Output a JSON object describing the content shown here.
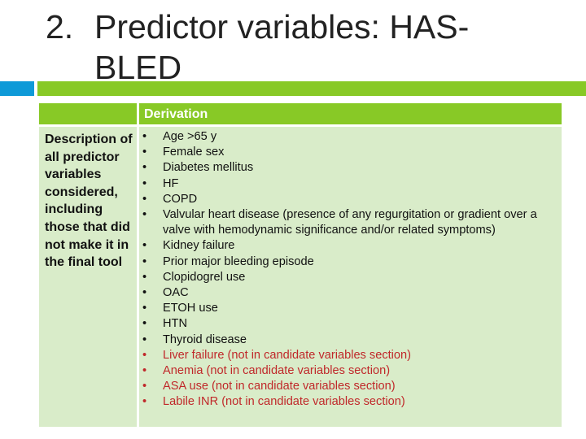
{
  "slide": {
    "title_number": "2.",
    "title_text": "Predictor variables: HAS-BLED",
    "accent_colors": {
      "blue": "#0e9ad8",
      "green": "#88c926",
      "cell": "#d9ecc9",
      "highlight_text": "#c0282a"
    }
  },
  "table": {
    "header": [
      "",
      "Derivation"
    ],
    "row_label": "Description of all predictor variables considered, including those that did not make it in the final tool",
    "items": [
      {
        "text": "Age >65 y",
        "highlight": false
      },
      {
        "text": "Female sex",
        "highlight": false
      },
      {
        "text": "Diabetes mellitus",
        "highlight": false
      },
      {
        "text": "HF",
        "highlight": false
      },
      {
        "text": "COPD",
        "highlight": false
      },
      {
        "text": "Valvular heart disease (presence of any regurgitation or gradient over a valve with hemodynamic significance and/or related symptoms)",
        "highlight": false
      },
      {
        "text": "Kidney failure",
        "highlight": false
      },
      {
        "text": "Prior major bleeding episode",
        "highlight": false
      },
      {
        "text": "Clopidogrel use",
        "highlight": false
      },
      {
        "text": "OAC",
        "highlight": false
      },
      {
        "text": "ETOH use",
        "highlight": false
      },
      {
        "text": "HTN",
        "highlight": false
      },
      {
        "text": "Thyroid disease",
        "highlight": false
      },
      {
        "text": "Liver failure (not in candidate variables section)",
        "highlight": true
      },
      {
        "text": "Anemia (not in candidate variables section)",
        "highlight": true
      },
      {
        "text": "ASA use (not in candidate variables section)",
        "highlight": true
      },
      {
        "text": "Labile INR (not in candidate variables section)",
        "highlight": true
      }
    ]
  }
}
